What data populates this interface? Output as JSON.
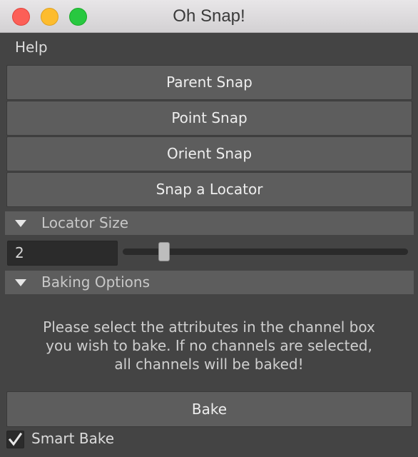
{
  "window": {
    "title": "Oh Snap!"
  },
  "menu": {
    "help": "Help"
  },
  "buttons": {
    "parent_snap": "Parent Snap",
    "point_snap": "Point Snap",
    "orient_snap": "Orient Snap",
    "snap_locator": "Snap a Locator",
    "bake": "Bake"
  },
  "locator_size": {
    "header": "Locator Size",
    "value": "2",
    "slider_fraction": 0.13
  },
  "baking": {
    "header": "Baking Options",
    "info_line1": "Please select the attributes in the channel box",
    "info_line2": "you wish to bake. If no channels are selected,",
    "info_line3": "all channels will be baked!",
    "smart_bake_label": "Smart Bake",
    "smart_bake_checked": true
  },
  "colors": {
    "background": "#444444",
    "button": "#5d5d5d",
    "traffic_close": "#fc5f57",
    "traffic_minimize": "#fdbc2e",
    "traffic_maximize": "#28c840"
  }
}
